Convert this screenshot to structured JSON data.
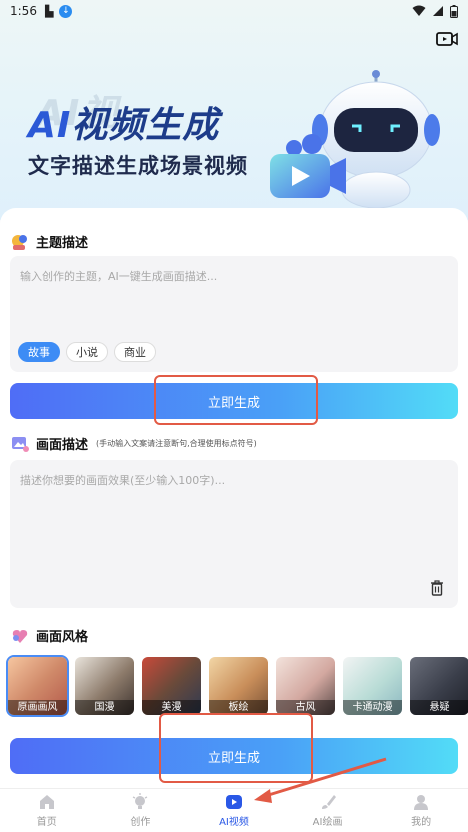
{
  "status_bar": {
    "time": "1:56"
  },
  "hero": {
    "title_ai": "AI",
    "title_rest": "视频生成",
    "ghost_text": "AI视",
    "subtitle": "文字描述生成场景视频"
  },
  "theme": {
    "heading": "主题描述",
    "placeholder": "输入创作的主题，AI一键生成画面描述...",
    "chips": [
      "故事",
      "小说",
      "商业"
    ],
    "generate_label": "立即生成"
  },
  "scene": {
    "heading": "画面描述",
    "hint": "(手动输入文案请注意断句,合理使用标点符号)",
    "placeholder": "描述你想要的画面效果(至少输入100字)..."
  },
  "style": {
    "heading": "画面风格",
    "items": [
      "原画画风",
      "国漫",
      "美漫",
      "板绘",
      "古风",
      "卡通动漫",
      "悬疑"
    ],
    "selected": "原画画风"
  },
  "bottom_generate_label": "立即生成",
  "tabs": [
    {
      "label": "首页",
      "icon": "home-icon"
    },
    {
      "label": "创作",
      "icon": "bulb-icon"
    },
    {
      "label": "AI视频",
      "icon": "video-icon",
      "active": true
    },
    {
      "label": "AI绘画",
      "icon": "brush-icon"
    },
    {
      "label": "我的",
      "icon": "user-icon"
    }
  ],
  "colors": {
    "accent": "#2a58e6",
    "annotation_red": "#e25a45"
  }
}
